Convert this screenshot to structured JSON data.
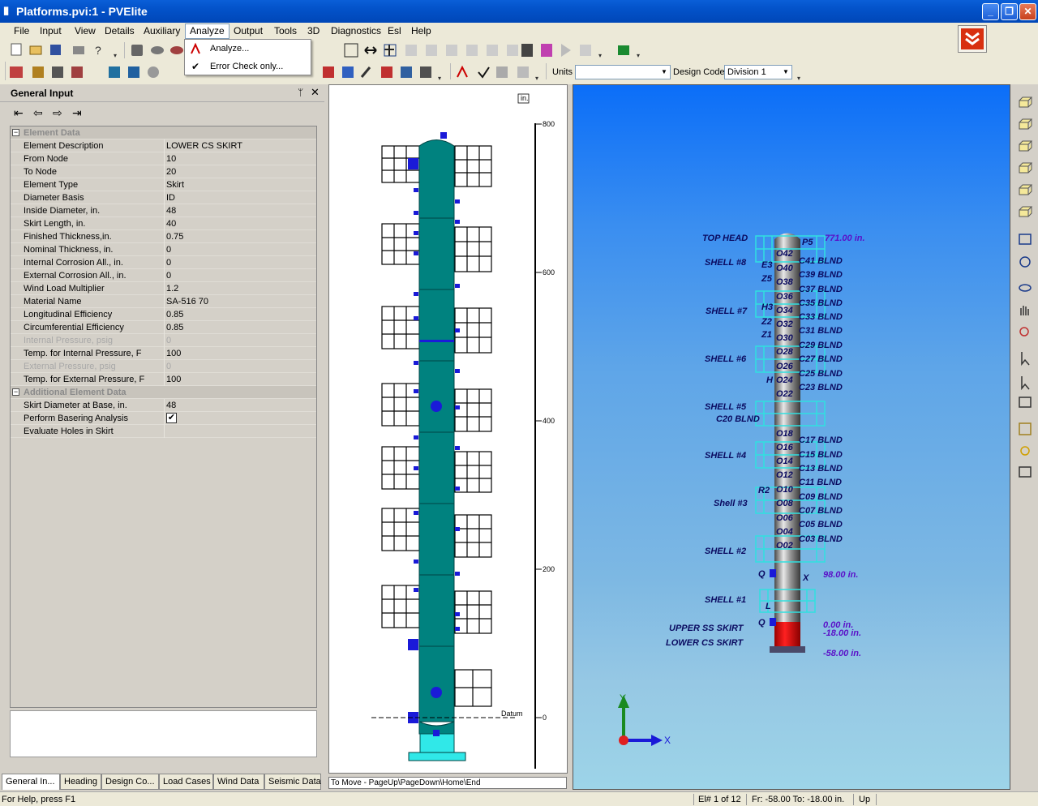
{
  "window": {
    "title": "Platforms.pvi:1 - PVElite"
  },
  "menu": [
    "File",
    "Input",
    "View",
    "Details",
    "Auxiliary",
    "Analyze",
    "Output",
    "Tools",
    "3D",
    "Diagnostics",
    "Esl",
    "Help"
  ],
  "analyze_menu": {
    "items": [
      {
        "label": "Analyze...",
        "checked": false
      },
      {
        "label": "Error Check only...",
        "checked": true
      }
    ]
  },
  "toolbar": {
    "units_label": "Units",
    "units_value": "",
    "design_code_label": "Design Code",
    "design_code_value": "Division 1"
  },
  "general_input": {
    "title": "General Input",
    "sections": [
      {
        "name": "Element Data",
        "rows": [
          {
            "label": "Element Description",
            "value": "LOWER CS SKIRT",
            "disabled": false
          },
          {
            "label": "From Node",
            "value": "10",
            "disabled": false
          },
          {
            "label": "To Node",
            "value": "20",
            "disabled": false
          },
          {
            "label": "Element Type",
            "value": "Skirt",
            "disabled": false
          },
          {
            "label": "Diameter Basis",
            "value": "ID",
            "disabled": false
          },
          {
            "label": "Inside Diameter, in.",
            "value": "48",
            "disabled": false
          },
          {
            "label": "Skirt Length, in.",
            "value": "40",
            "disabled": false
          },
          {
            "label": "Finished Thickness,in.",
            "value": "0.75",
            "disabled": false
          },
          {
            "label": "Nominal Thickness, in.",
            "value": "0",
            "disabled": false
          },
          {
            "label": "Internal Corrosion All., in.",
            "value": "0",
            "disabled": false
          },
          {
            "label": "External Corrosion All., in.",
            "value": "0",
            "disabled": false
          },
          {
            "label": "Wind Load Multiplier",
            "value": "1.2",
            "disabled": false
          },
          {
            "label": "Material Name",
            "value": "SA-516 70",
            "disabled": false
          },
          {
            "label": "Longitudinal Efficiency",
            "value": "0.85",
            "disabled": false
          },
          {
            "label": "Circumferential Efficiency",
            "value": "0.85",
            "disabled": false
          },
          {
            "label": "Internal Pressure, psig",
            "value": "0",
            "disabled": true
          },
          {
            "label": "Temp. for Internal Pressure, F",
            "value": "100",
            "disabled": false
          },
          {
            "label": "External Pressure, psig",
            "value": "0",
            "disabled": true
          },
          {
            "label": "Temp. for External Pressure, F",
            "value": "100",
            "disabled": false
          }
        ]
      },
      {
        "name": "Additional Element Data",
        "rows": [
          {
            "label": "Skirt Diameter at Base, in.",
            "value": "48",
            "disabled": false
          },
          {
            "label": "Perform Basering Analysis",
            "value": "",
            "checkbox": true,
            "disabled": false
          },
          {
            "label": "Evaluate Holes in Skirt",
            "value": "",
            "disabled": false
          }
        ]
      }
    ]
  },
  "bottom_tabs": [
    "General In...",
    "Heading",
    "Design Co...",
    "Load Cases",
    "Wind Data",
    "Seismic Data"
  ],
  "view2d": {
    "unit": "in.",
    "scale": [
      "800",
      "600",
      "400",
      "200",
      "0"
    ],
    "datum": "Datum",
    "move_hint": "To Move - PageUp\\PageDown\\Home\\End"
  },
  "view3d": {
    "labels": [
      {
        "text": "TOP HEAD"
      },
      {
        "text": "SHELL #8"
      },
      {
        "text": "SHELL #7"
      },
      {
        "text": "SHELL #6"
      },
      {
        "text": "SHELL #5"
      },
      {
        "text": "C20 BLND"
      },
      {
        "text": "SHELL #4"
      },
      {
        "text": "Shell #3"
      },
      {
        "text": "SHELL #2"
      },
      {
        "text": "SHELL #1"
      },
      {
        "text": "UPPER SS SKIRT"
      },
      {
        "text": "LOWER CS SKIRT"
      }
    ],
    "elevations": [
      "771.00 in.",
      "98.00 in.",
      "0.00 in.",
      "-18.00 in.",
      "-58.00 in."
    ],
    "nozzles_left": [
      "O42",
      "E3",
      "O40",
      "Z5",
      "O38",
      "O36",
      "H3",
      "O34",
      "Z2",
      "O32",
      "Z1",
      "O30",
      "O28",
      "O26",
      "H",
      "O24",
      "O22",
      "O18",
      "O16",
      "O14",
      "O12",
      "R2",
      "O10",
      "O08",
      "O06",
      "O04",
      "O02",
      "Q",
      "L",
      "Q"
    ],
    "nozzles_right": [
      "P5",
      "C41 BLND",
      "C39 BLND",
      "C37 BLND",
      "C35 BLND",
      "C33 BLND",
      "C31 BLND",
      "C29 BLND",
      "C27 BLND",
      "C25 BLND",
      "C23 BLND",
      "C17 BLND",
      "C15 BLND",
      "C13 BLND",
      "C11 BLND",
      "C09 BLND",
      "C07 BLND",
      "C05 BLND",
      "C03 BLND",
      "X"
    ],
    "axes": {
      "y": "Y",
      "x": "X"
    }
  },
  "status": {
    "help": "For Help, press F1",
    "element": "El# 1 of 12",
    "range": "Fr: -58.00 To: -18.00 in.",
    "direction": "Up"
  },
  "colors": {
    "vessel": "#00827f",
    "vessel_dark": "#005c5a",
    "nozzle": "#1a1ad8",
    "skirt_red": "#e01010",
    "sky_top": "#0b6ef8",
    "platform": "#30e0e0"
  }
}
